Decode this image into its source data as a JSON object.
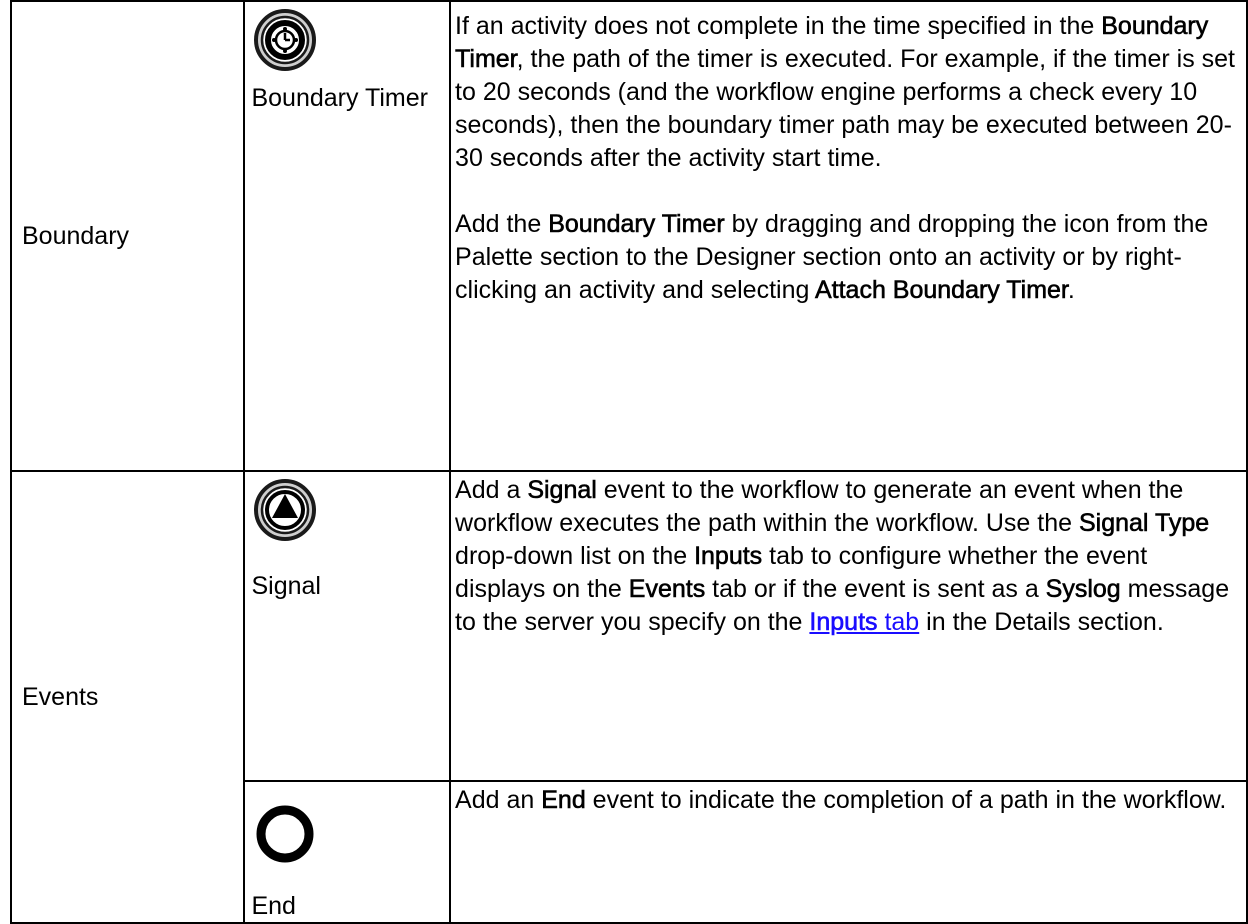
{
  "rows": {
    "boundary": {
      "category": "Boundary",
      "icon": "boundary-timer-icon",
      "icon_label": "Boundary Timer",
      "p1": {
        "t1": "If an activity does not complete in the time specified in the ",
        "b1": "Boundary Timer",
        "t2": ", the path of the timer is executed. For example, if the timer is set to 20 seconds (and the workflow engine performs a check every 10 seconds), then the boundary timer path may be executed between 20-30 seconds after the activity start time."
      },
      "p2": {
        "t1": "Add the ",
        "b1": "Boundary Timer",
        "t2": " by dragging and dropping the icon from the Palette section to the Designer section onto an activity or by right-clicking an activity and selecting ",
        "b2": "Attach Boundary Timer",
        "t3": "."
      }
    },
    "events": {
      "category": "Events",
      "signal": {
        "icon": "signal-icon",
        "icon_label": "Signal",
        "t1": "Add a ",
        "b1": "Signal",
        "t2": " event to the workflow to generate an event when the workflow executes the path within the workflow. Use the ",
        "b2": "Signal Type",
        "t3": " drop-down list on the ",
        "b3": "Inputs",
        "t4": " tab to configure whether the event displays on the ",
        "b4": "Events",
        "t5": " tab or if the event is sent as a ",
        "b5": "Syslog",
        "t6": " message to the server you specify on the ",
        "link_bold": "Inputs",
        "link_rest": " tab",
        "t7": " in the Details section."
      },
      "end": {
        "icon": "end-circle-icon",
        "icon_label": "End",
        "t1": "Add an ",
        "b1": "End",
        "t2": " event to indicate the completion of a path in the workflow."
      }
    }
  }
}
